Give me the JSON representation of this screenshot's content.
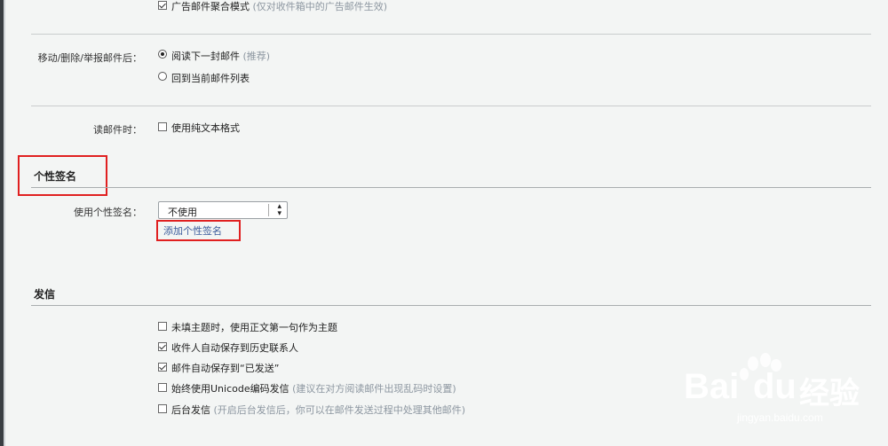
{
  "ads": {
    "checked": true,
    "label": "广告邮件聚合模式",
    "hint": "(仅对收件箱中的广告邮件生效)"
  },
  "after_action": {
    "label": "移动/删除/举报邮件后：",
    "option1": "阅读下一封邮件",
    "option1_hint": "(推荐)",
    "option2": "回到当前邮件列表",
    "selected": "option1"
  },
  "reading": {
    "label": "读邮件时：",
    "option": "使用纯文本格式",
    "checked": false
  },
  "signature": {
    "title": "个性签名",
    "label": "使用个性签名：",
    "select_value": "不使用",
    "add_link": "添加个性签名"
  },
  "send": {
    "title": "发信",
    "options": [
      {
        "label": "未填主题时，使用正文第一句作为主题",
        "hint": "",
        "checked": false
      },
      {
        "label": "收件人自动保存到历史联系人",
        "hint": "",
        "checked": true
      },
      {
        "label": "邮件自动保存到“已发送”",
        "hint": "",
        "checked": true
      },
      {
        "label": "始终使用Unicode编码发信",
        "hint": "(建议在对方阅读邮件出现乱码时设置)",
        "checked": false
      },
      {
        "label": "后台发信",
        "hint": "(开启后台发信后，你可以在邮件发送过程中处理其他邮件)",
        "checked": false
      }
    ]
  },
  "watermark": {
    "brand": "Bai",
    "brand2": "du",
    "cn": "经验",
    "url": "jingyan.baidu.com"
  }
}
